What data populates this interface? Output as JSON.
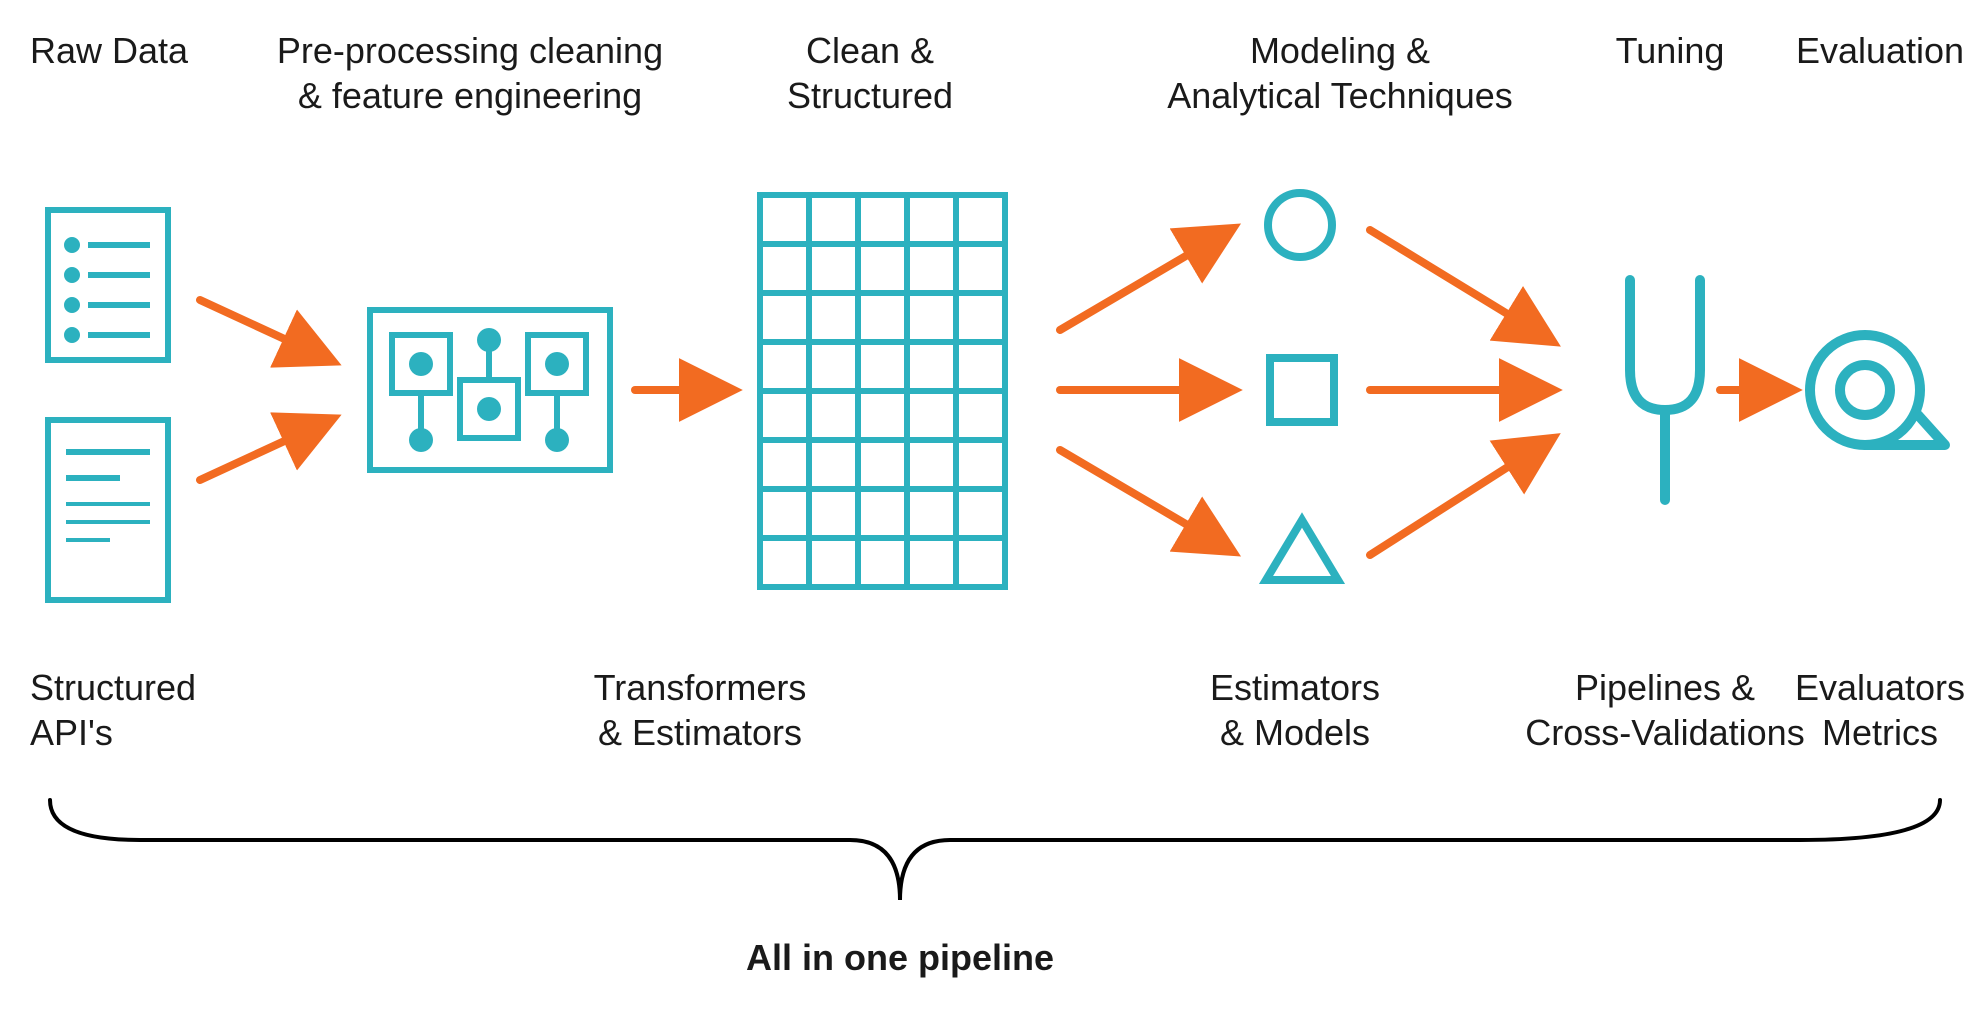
{
  "colors": {
    "teal": "#2CB1BF",
    "orange": "#F26B21",
    "text": "#1a1a1a"
  },
  "stages": {
    "raw": {
      "top": "Raw Data",
      "bottom": "Structured\nAPI's"
    },
    "pre": {
      "top": "Pre-processing cleaning\n& feature engineering",
      "bottom": "Transformers\n& Estimators"
    },
    "clean": {
      "top": "Clean &\nStructured",
      "bottom": ""
    },
    "model": {
      "top": "Modeling &\nAnalytical Techniques",
      "bottom": "Estimators\n& Models"
    },
    "tune": {
      "top": "Tuning",
      "bottom": "Pipelines &\nCross-Validations"
    },
    "eval": {
      "top": "Evaluation",
      "bottom": "Evaluators\nMetrics"
    }
  },
  "summary": "All in one pipeline"
}
